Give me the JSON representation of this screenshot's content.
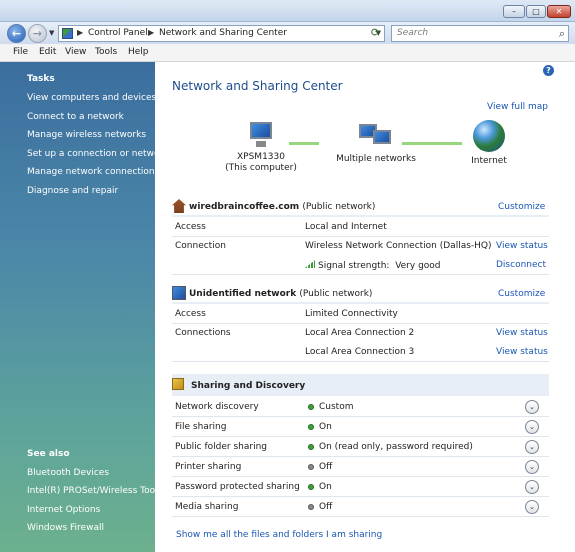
{
  "window": {
    "controls": {
      "minimize": "–",
      "maximize": "□",
      "close": "✕"
    },
    "icons": {
      "minimize": "minimize-icon",
      "maximize": "maximize-icon",
      "close": "close-icon"
    }
  },
  "nav": {
    "back_icon": "back-arrow-icon",
    "forward_icon": "forward-arrow-icon",
    "breadcrumb": [
      "Control Panel",
      "Network and Sharing Center"
    ],
    "search_placeholder": "Search"
  },
  "menu": [
    "File",
    "Edit",
    "View",
    "Tools",
    "Help"
  ],
  "tasks": {
    "heading": "Tasks",
    "items": [
      "View computers and devices",
      "Connect to a network",
      "Manage wireless networks",
      "Set up a connection or network",
      "Manage network connections",
      "Diagnose and repair"
    ]
  },
  "see_also": {
    "heading": "See also",
    "items": [
      "Bluetooth Devices",
      "Intel(R) PROSet/Wireless Tools",
      "Internet Options",
      "Windows Firewall"
    ]
  },
  "main": {
    "title": "Network and Sharing Center",
    "view_full_map": "View full map",
    "map": {
      "computer_name": "XPSM1330",
      "computer_sub": "(This computer)",
      "middle": "Multiple networks",
      "internet": "Internet"
    },
    "network1": {
      "name": "wiredbraincoffee.com",
      "type": "(Public network)",
      "customize": "Customize",
      "rows": {
        "access_label": "Access",
        "access_value": "Local and Internet",
        "connection_label": "Connection",
        "connection_value": "Wireless Network Connection (Dallas-HQ)",
        "view_status": "View status",
        "signal_label": "Signal strength:",
        "signal_value": "Very good",
        "disconnect": "Disconnect"
      }
    },
    "network2": {
      "name": "Unidentified network",
      "type": "(Public network)",
      "customize": "Customize",
      "rows": {
        "access_label": "Access",
        "access_value": "Limited Connectivity",
        "connections_label": "Connections",
        "conn1": "Local Area Connection 2",
        "conn1_link": "View status",
        "conn2": "Local Area Connection 3",
        "conn2_link": "View status"
      }
    },
    "sharing": {
      "heading": "Sharing and Discovery",
      "items": [
        {
          "label": "Network discovery",
          "value": "Custom",
          "status": "on"
        },
        {
          "label": "File sharing",
          "value": "On",
          "status": "on"
        },
        {
          "label": "Public folder sharing",
          "value": "On (read only, password required)",
          "status": "on"
        },
        {
          "label": "Printer sharing",
          "value": "Off",
          "status": "off"
        },
        {
          "label": "Password protected sharing",
          "value": "On",
          "status": "on"
        },
        {
          "label": "Media sharing",
          "value": "Off",
          "status": "off"
        }
      ],
      "expand_glyph": "⌄"
    },
    "footer_link": "Show me all the files and folders I am sharing"
  }
}
